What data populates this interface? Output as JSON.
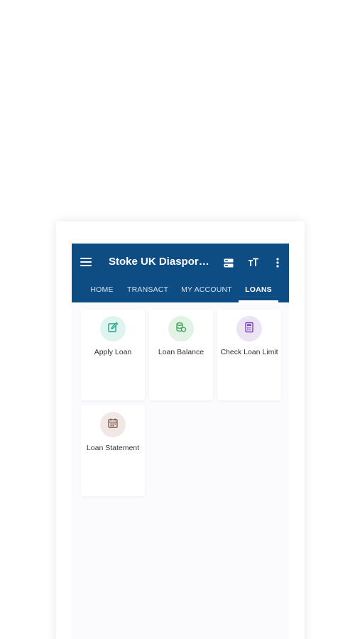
{
  "app": {
    "title": "Stoke UK Diaspora ...",
    "colors": {
      "appbar": "#0e4d84",
      "background": "#fbfbfe"
    }
  },
  "toolbar": {
    "menu_icon": "hamburger-menu-icon",
    "actions": [
      {
        "icon": "server-icon"
      },
      {
        "icon": "font-size-icon"
      },
      {
        "icon": "more-vert-icon"
      }
    ]
  },
  "tabs": [
    {
      "label": "HOME",
      "active": false
    },
    {
      "label": "TRANSACT",
      "active": false
    },
    {
      "label": "MY ACCOUNT",
      "active": false
    },
    {
      "label": "LOANS",
      "active": true
    }
  ],
  "tiles": [
    {
      "label": "Apply Loan",
      "icon": "edit-document-icon",
      "icon_color": "#1fa38a",
      "icon_bg": "#dff4ef"
    },
    {
      "label": "Loan Balance",
      "icon": "coins-stack-icon",
      "icon_color": "#3aa55a",
      "icon_bg": "#e2f3e6"
    },
    {
      "label": "Check Loan Limit",
      "icon": "calculator-icon",
      "icon_color": "#7b47b8",
      "icon_bg": "#ece3f5"
    },
    {
      "label": "Loan Statement",
      "icon": "calendar-icon",
      "icon_color": "#7a5a4f",
      "icon_bg": "#f1e8e5"
    }
  ]
}
